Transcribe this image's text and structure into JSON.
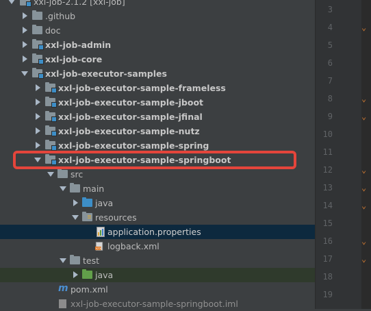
{
  "tree": {
    "root": {
      "label": "xxl-job-2.1.2 [xxl-job]"
    },
    "items": [
      {
        "label": ".github"
      },
      {
        "label": "doc"
      },
      {
        "label": "xxl-job-admin"
      },
      {
        "label": "xxl-job-core"
      },
      {
        "label": "xxl-job-executor-samples"
      },
      {
        "label": "xxl-job-executor-sample-frameless"
      },
      {
        "label": "xxl-job-executor-sample-jboot"
      },
      {
        "label": "xxl-job-executor-sample-jfinal"
      },
      {
        "label": "xxl-job-executor-sample-nutz"
      },
      {
        "label": "xxl-job-executor-sample-spring"
      },
      {
        "label": "xxl-job-executor-sample-springboot"
      },
      {
        "label": "src"
      },
      {
        "label": "main"
      },
      {
        "label": "java"
      },
      {
        "label": "resources"
      },
      {
        "label": "application.properties"
      },
      {
        "label": "logback.xml"
      },
      {
        "label": "test"
      },
      {
        "label": "java"
      },
      {
        "label": "pom.xml"
      },
      {
        "label": "xxl-job-executor-sample-springboot.iml"
      }
    ]
  },
  "gutter": {
    "line_numbers": [
      "3",
      "4",
      "5",
      "6",
      "7",
      "8",
      "9",
      "10",
      "11",
      "12",
      "13",
      "14",
      "15",
      "16",
      "17",
      "18",
      "19"
    ]
  },
  "colors": {
    "highlight_box": "#e4453b",
    "selection": "#0d293e"
  }
}
